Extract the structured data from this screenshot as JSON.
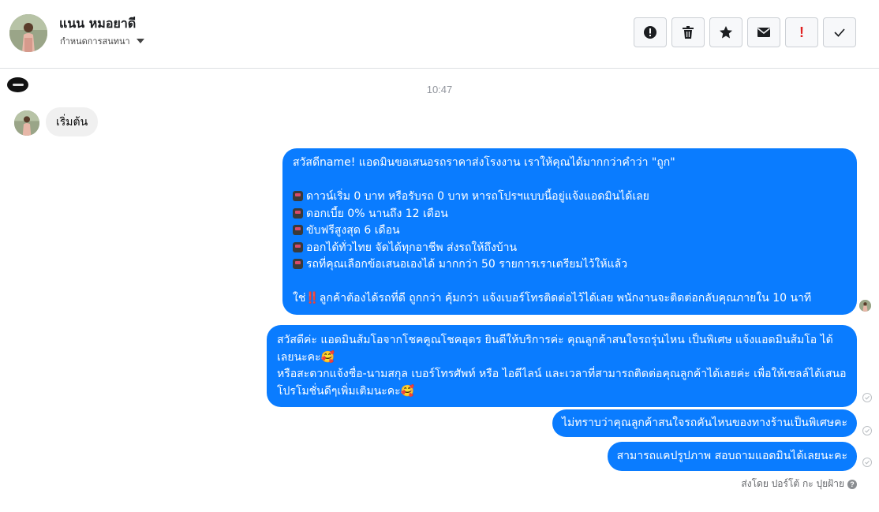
{
  "header": {
    "contact_name": "แนน หมอยาดี",
    "conversation_status": "กำหนดการสนทนา",
    "actions": [
      {
        "icon": "alert-circle-icon",
        "label": "report"
      },
      {
        "icon": "trash-icon",
        "label": "delete"
      },
      {
        "icon": "star-icon",
        "label": "star"
      },
      {
        "icon": "envelope-icon",
        "label": "mark-unread"
      },
      {
        "icon": "exclamation-icon",
        "label": "!"
      },
      {
        "icon": "checkmark-icon",
        "label": "done"
      }
    ]
  },
  "thread": {
    "time_divider": "10:47",
    "incoming": {
      "text": "เริ่มต้น"
    },
    "outgoing": [
      {
        "lines": [
          "สวัสดีname! แอดมินขอเสนอรถราคาส่งโรงงาน เราให้คุณได้มากกว่าคำว่า \"ถูก\"",
          "",
          "ดาวน์เริ่ม 0 บาท หรือรับรถ 0 บาท หารถโปรฯแบบนี้อยู่แจ้งแอดมินได้เลย",
          "ดอกเบี้ย 0% นานถึง 12 เดือน",
          "ขับฟรีสูงสุด 6 เดือน",
          "ออกได้ทั่วไทย จัดได้ทุกอาชีพ ส่งรถให้ถึงบ้าน",
          "รถที่คุณเลือกข้อเสนอเองได้ มากกว่า 50 รายการเราเตรียมไว้ให้แล้ว",
          "",
          "ใช่",
          "ลูกค้าต้องได้รถที่ดี ถูกกว่า คุ้มกว่า แจ้งเบอร์โทรติดต่อไว้ได้เลย พนักงานจะติดต่อกลับคุณภายใน 10 นาที"
        ]
      },
      {
        "lines": [
          "สวัสดีค่ะ แอดมินส้มโอจากโชคคูณโชคอุดร ยินดีให้บริการค่ะ   คุณลูกค้าสนใจรถรุ่นไหน เป็นพิเศษ แจ้งแอดมินส้มโอ ได้เลยนะคะ🥰",
          "หรือสะดวกแจ้งชื่อ-นามสกุล เบอร์โทรศัพท์ หรือ ไอดีไลน์ และเวลาที่สามารถติดต่อคุณลูกค้าได้เลยค่ะ เพื่อให้เซลล์ได้เสนอโปรโมชั่นดีๆเพิ่มเติมนะคะ🥰"
        ]
      },
      {
        "text": "ไม่ทราบว่าคุณลูกค้าสนใจรถคันไหนของทางร้านเป็นพิเศษคะ"
      },
      {
        "text": "สามารถแคปรูปภาพ สอบถามแอดมินได้เลยนะคะ"
      }
    ],
    "sent_by": "ส่งโดย ปอร์โต้ กะ ปุยฝ้าย",
    "sent_by_help": "?",
    "warning_glyph": "‼️"
  },
  "colors": {
    "outgoing_bubble": "#0a7cff",
    "incoming_bubble": "#f0f0f0",
    "divider": "#dddfe2"
  }
}
